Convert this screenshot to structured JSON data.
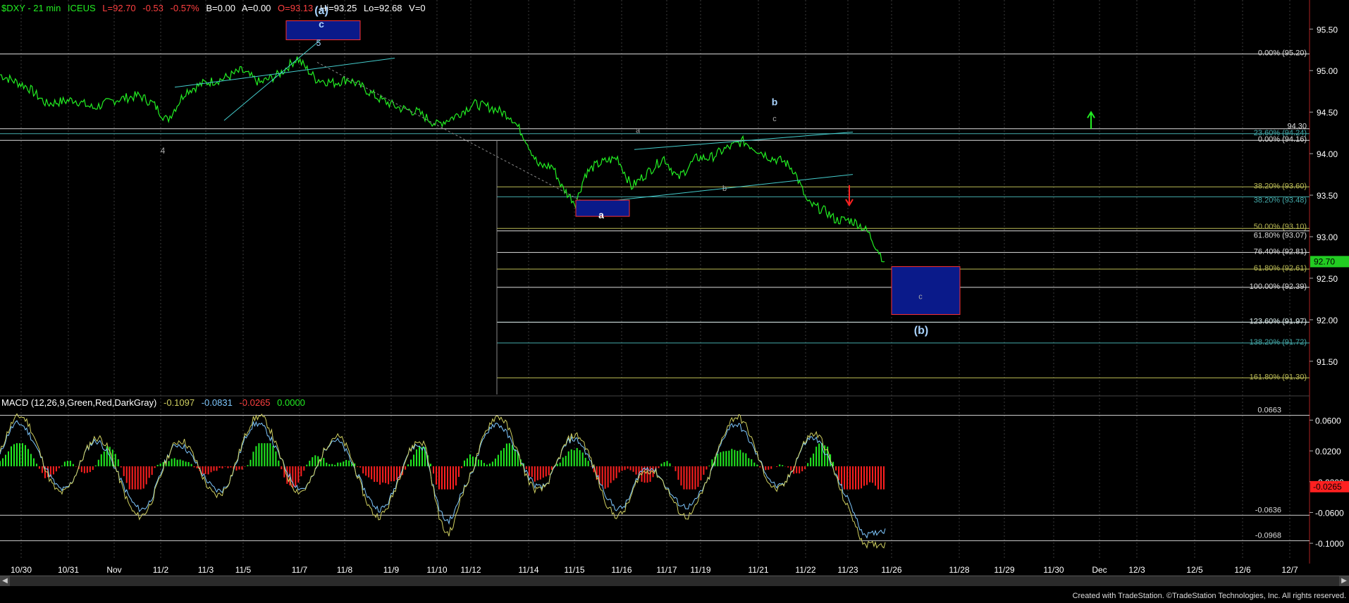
{
  "header": {
    "symbol": "$DXY - 21 min",
    "exchange": "ICEUS",
    "last": "L=92.70",
    "change": "-0.53",
    "change_pct": "-0.57%",
    "bid": "B=0.00",
    "ask": "A=0.00",
    "open": "O=93.13",
    "high": "Hi=93.25",
    "low": "Lo=92.68",
    "volume": "V=0"
  },
  "macd_header": {
    "label": "MACD (12,26,9,Green,Red,DarkGray)",
    "v1": "-0.1097",
    "v2": "-0.0831",
    "v3": "-0.0265",
    "v4": "0.0000"
  },
  "colors": {
    "price": "#22ee22",
    "signal": "#cfcf60",
    "macd_line": "#7fc8ff",
    "hist_pos": "#22ee22",
    "hist_neg": "#ff2020",
    "box_fill": "#0a1a8a",
    "box_border": "#ff3030",
    "fib_white": "#dddddd",
    "fib_olive": "#bbbb55",
    "fib_cyan": "#44aaaa",
    "axis_bg": "#000000",
    "last_price_tag": "#22cc22"
  },
  "chart_data": [
    {
      "type": "line",
      "title": "$DXY - 21 min",
      "x_ticks": [
        "10/30",
        "10/31",
        "Nov",
        "11/2",
        "11/3",
        "11/5",
        "11/7",
        "11/8",
        "11/9",
        "11/10",
        "11/12",
        "11/14",
        "11/15",
        "11/16",
        "11/17",
        "11/19",
        "11/21",
        "11/22",
        "11/23",
        "11/26",
        "11/28",
        "11/29",
        "11/30",
        "Dec",
        "12/3",
        "12/5",
        "12/6",
        "12/7"
      ],
      "y_ticks": [
        "95.50",
        "95.00",
        "94.50",
        "94.00",
        "93.50",
        "93.00",
        "92.50",
        "92.00",
        "91.50"
      ],
      "ylim": [
        91.1,
        95.85
      ],
      "last_price": "92.70",
      "series": [
        {
          "name": "$DXY",
          "x": [
            0.0,
            0.6,
            1.0,
            1.6,
            2.0,
            2.5,
            3.0,
            3.3,
            3.6,
            4.0,
            4.4,
            4.8,
            5.2,
            5.6,
            6.0,
            6.4,
            6.8,
            7.2,
            7.5,
            7.8,
            8.2,
            8.6,
            9.0,
            9.4,
            9.8,
            10.2,
            10.6,
            11.0,
            11.3,
            11.6,
            11.9,
            12.1,
            12.4,
            12.6,
            12.8,
            13.0,
            13.3,
            13.6,
            14.0,
            14.3,
            14.6,
            15.0,
            15.3,
            15.6,
            16.0,
            16.3,
            16.6,
            16.9,
            17.1,
            17.4,
            17.8,
            18.0,
            18.3,
            18.5,
            18.7,
            18.9,
            19.05
          ],
          "y": [
            94.95,
            94.8,
            94.6,
            94.65,
            94.55,
            94.65,
            94.7,
            94.6,
            94.4,
            94.75,
            94.85,
            94.9,
            95.0,
            94.85,
            94.95,
            95.15,
            94.9,
            94.85,
            94.9,
            94.8,
            94.65,
            94.55,
            94.5,
            94.35,
            94.45,
            94.6,
            94.55,
            94.45,
            94.2,
            93.85,
            93.85,
            93.6,
            93.4,
            93.75,
            93.85,
            93.9,
            93.95,
            93.6,
            93.8,
            93.95,
            93.7,
            93.95,
            93.95,
            94.05,
            94.15,
            94.05,
            93.95,
            93.9,
            93.8,
            93.4,
            93.3,
            93.2,
            93.2,
            93.15,
            93.05,
            92.85,
            92.7
          ]
        }
      ],
      "fib_levels": [
        {
          "label": "0.00% (95.20)",
          "value": 95.2,
          "color": "white"
        },
        {
          "label": "94.30",
          "value": 94.3,
          "color": "white"
        },
        {
          "label": "23.60% (94.24)",
          "value": 94.24,
          "color": "cyan"
        },
        {
          "label": "0.00% (94.16)",
          "value": 94.16,
          "color": "white"
        },
        {
          "label": "38.20% (93.60)",
          "value": 93.6,
          "color": "olive"
        },
        {
          "label": "38.20% (93.48)",
          "value": 93.48,
          "color": "cyan"
        },
        {
          "label": "50.00% (93.10)",
          "value": 93.1,
          "color": "olive"
        },
        {
          "label": "61.80% (93.07)",
          "value": 93.07,
          "color": "white"
        },
        {
          "label": "76.40% (92.81)",
          "value": 92.81,
          "color": "white"
        },
        {
          "label": "61.80% (92.61)",
          "value": 92.61,
          "color": "olive"
        },
        {
          "label": "100.00% (92.39)",
          "value": 92.39,
          "color": "white"
        },
        {
          "label": "123.60% (91.97)",
          "value": 91.97,
          "color": "cyan"
        },
        {
          "label": "123.60% (91.97)",
          "value": 91.97,
          "color": "white"
        },
        {
          "label": "138.20% (91.72)",
          "value": 91.72,
          "color": "cyan"
        },
        {
          "label": "161.80% (91.30)",
          "value": 91.3,
          "color": "olive"
        }
      ],
      "wave_labels": [
        "(a)",
        "c",
        "5",
        "4",
        "a",
        "a",
        "b",
        "c",
        "b",
        "c",
        "(b)"
      ]
    },
    {
      "type": "line",
      "title": "MACD (12,26,9,Green,Red,DarkGray)",
      "y_ticks": [
        "0.0600",
        "0.0200",
        "-0.0200",
        "-0.0600",
        "-0.1000"
      ],
      "ylim": [
        -0.12,
        0.075
      ],
      "ref_levels": [
        {
          "label": "0.0663",
          "value": 0.0663
        },
        {
          "label": "-0.0636",
          "value": -0.0636
        },
        {
          "label": "-0.0968",
          "value": -0.0968
        }
      ],
      "last_value": "-0.0265"
    }
  ],
  "footer": "Created with TradeStation. ©TradeStation Technologies, Inc. All rights reserved."
}
